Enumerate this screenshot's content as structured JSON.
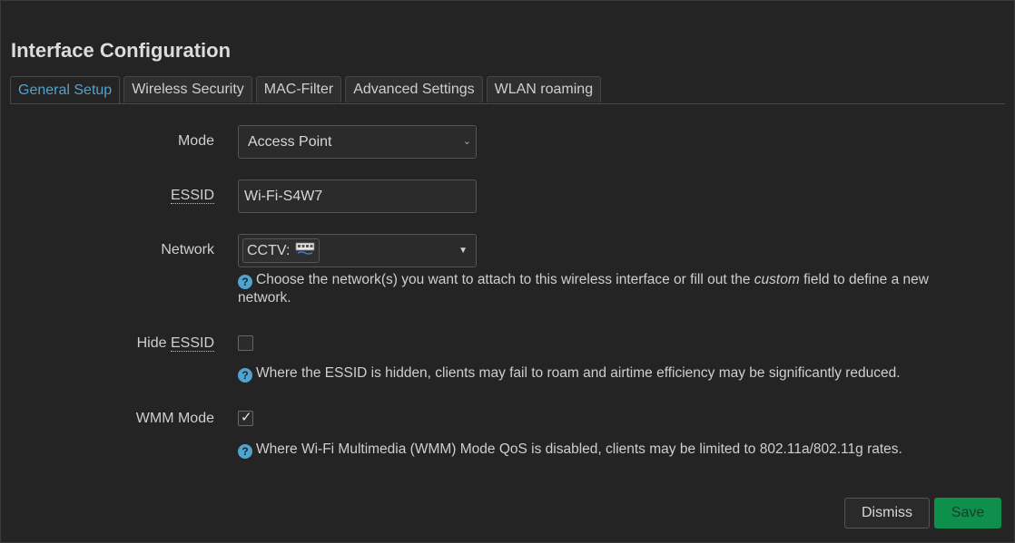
{
  "dialog": {
    "title": "Interface Configuration"
  },
  "tabs": [
    {
      "label": "General Setup",
      "active": true
    },
    {
      "label": "Wireless Security",
      "active": false
    },
    {
      "label": "MAC-Filter",
      "active": false
    },
    {
      "label": "Advanced Settings",
      "active": false
    },
    {
      "label": "WLAN roaming",
      "active": false
    }
  ],
  "form": {
    "mode": {
      "label": "Mode",
      "value": "Access Point"
    },
    "essid": {
      "label": "ESSID",
      "value": "Wi-Fi-S4W7"
    },
    "network": {
      "label": "Network",
      "chip_label": "CCTV:",
      "chip_icon": "network-interface-icon",
      "help_before": "Choose the network(s) you want to attach to this wireless interface or fill out the ",
      "help_emphasis": "custom",
      "help_after": " field to define a new network."
    },
    "hide_essid": {
      "label_prefix": "Hide ",
      "label_abbr": "ESSID",
      "checked": false,
      "help": "Where the ESSID is hidden, clients may fail to roam and airtime efficiency may be significantly reduced."
    },
    "wmm_mode": {
      "label": "WMM Mode",
      "checked": true,
      "help": "Where Wi-Fi Multimedia (WMM) Mode QoS is disabled, clients may be limited to 802.11a/802.11g rates."
    }
  },
  "help_icon": "?",
  "buttons": {
    "dismiss": "Dismiss",
    "save": "Save"
  },
  "colors": {
    "accent": "#4fa3d1",
    "save": "#0f8f4c",
    "background": "#242424"
  }
}
